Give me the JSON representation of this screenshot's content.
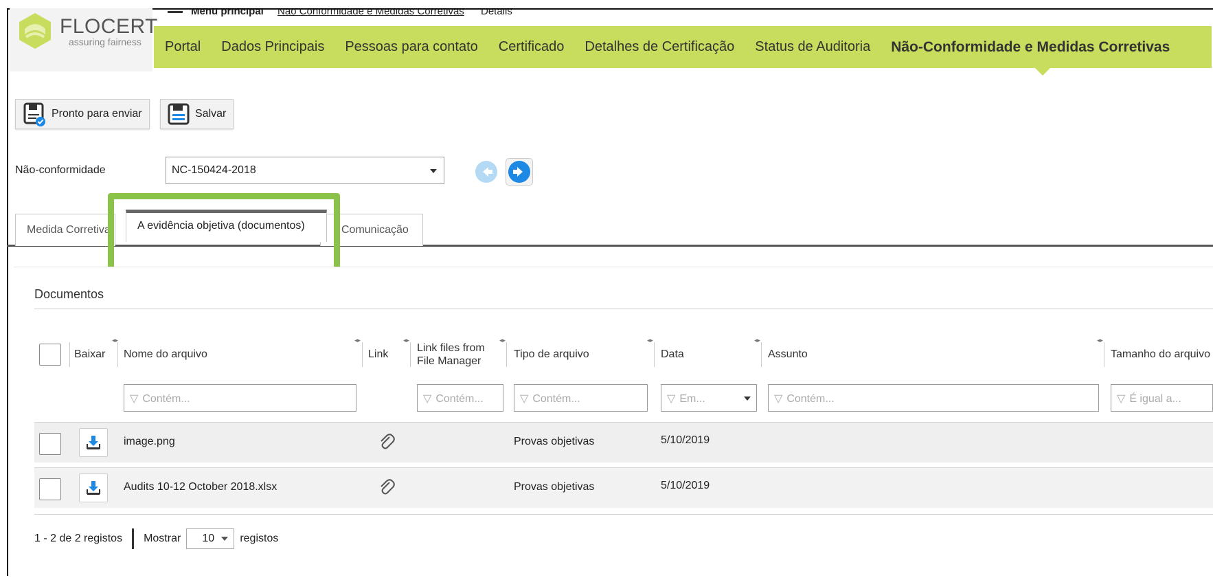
{
  "breadcrumb": {
    "menu_label": "Menu principal",
    "link": "Não Conformidade e Medidas Corretivas",
    "current": "Details"
  },
  "brand": {
    "name": "FLOCERT",
    "tagline": "assuring fairness",
    "color": "#c8dc5e"
  },
  "nav": {
    "items": [
      "Portal",
      "Dados Principais",
      "Pessoas para contato",
      "Certificado",
      "Detalhes de Certificação",
      "Status de Auditoria"
    ],
    "active": "Não-Conformidade e Medidas Corretivas"
  },
  "toolbar": {
    "ready_label": "Pronto para enviar",
    "save_label": "Salvar"
  },
  "nc": {
    "label": "Não-conformidade",
    "value": "NC-150424-2018"
  },
  "tabs": {
    "corrective": "Medida Corretiva",
    "evidence": "A evidência objetiva (documentos)",
    "communication": "Comunicação"
  },
  "documents": {
    "title": "Documentos",
    "columns": {
      "download": "Baixar",
      "file_name": "Nome do arquivo",
      "link": "Link",
      "link_files_1": "Link files from",
      "link_files_2": "File Manager",
      "file_type": "Tipo de arquivo",
      "date": "Data",
      "subject": "Assunto",
      "file_size": "Tamanho do arquivo"
    },
    "filters": {
      "contains": "Contém...",
      "in": "Em...",
      "equals": "É igual a..."
    },
    "rows": [
      {
        "file_name": "image.png",
        "file_type": "Provas objetivas",
        "date": "5/10/2019"
      },
      {
        "file_name": "Audits 10-12 October 2018.xlsx",
        "file_type": "Provas objetivas",
        "date": "5/10/2019"
      }
    ]
  },
  "pager": {
    "range": "1 - 2 de 2 registos",
    "show": "Mostrar",
    "page_size": "10",
    "records": "registos"
  },
  "colors": {
    "highlight": "#8bc34a",
    "accent_blue": "#1e88e5"
  }
}
